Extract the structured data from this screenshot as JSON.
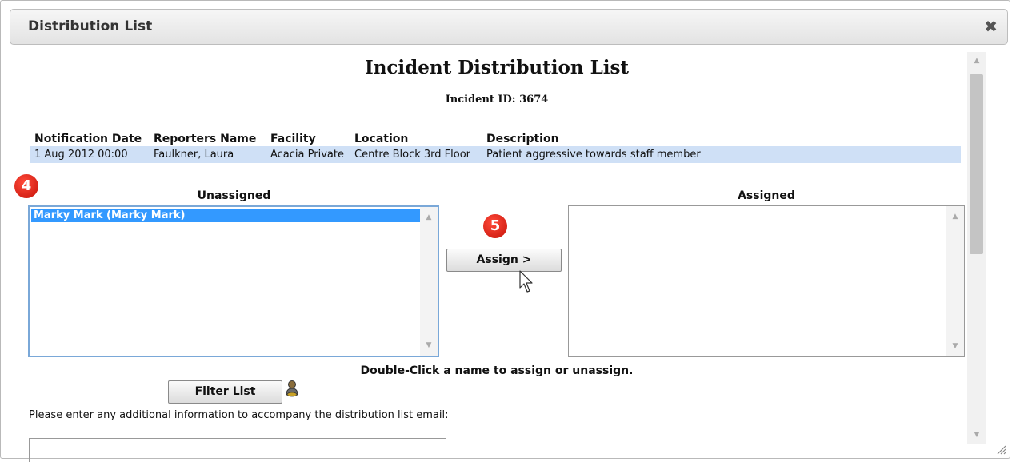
{
  "dialog": {
    "title": "Distribution List",
    "close_glyph": "✖"
  },
  "page": {
    "heading": "Incident Distribution List",
    "incident_id": "Incident ID: 3674"
  },
  "table": {
    "headers": [
      "Notification Date",
      "Reporters Name",
      "Facility",
      "Location",
      "Description"
    ],
    "row": [
      "1 Aug 2012 00:00",
      "Faulkner, Laura",
      "Acacia Private",
      "Centre Block 3rd Floor",
      "Patient aggressive towards staff member"
    ]
  },
  "badges": {
    "step4": "4",
    "step5": "5"
  },
  "unassigned": {
    "label": "Unassigned",
    "items": [
      "Marky Mark (Marky Mark)"
    ]
  },
  "assigned": {
    "label": "Assigned",
    "items": []
  },
  "actions": {
    "assign_label": "Assign >",
    "filter_label": "Filter List"
  },
  "hint": "Double-Click a name to assign or unassign.",
  "additional_info": {
    "prompt": "Please enter any additional information to accompany the distribution list email:",
    "value": ""
  },
  "colors": {
    "row_highlight": "#cfe0f6",
    "selection": "#3399ff",
    "badge": "#d81e0e"
  },
  "icons": {
    "filter_icon": "person-filter-icon"
  }
}
